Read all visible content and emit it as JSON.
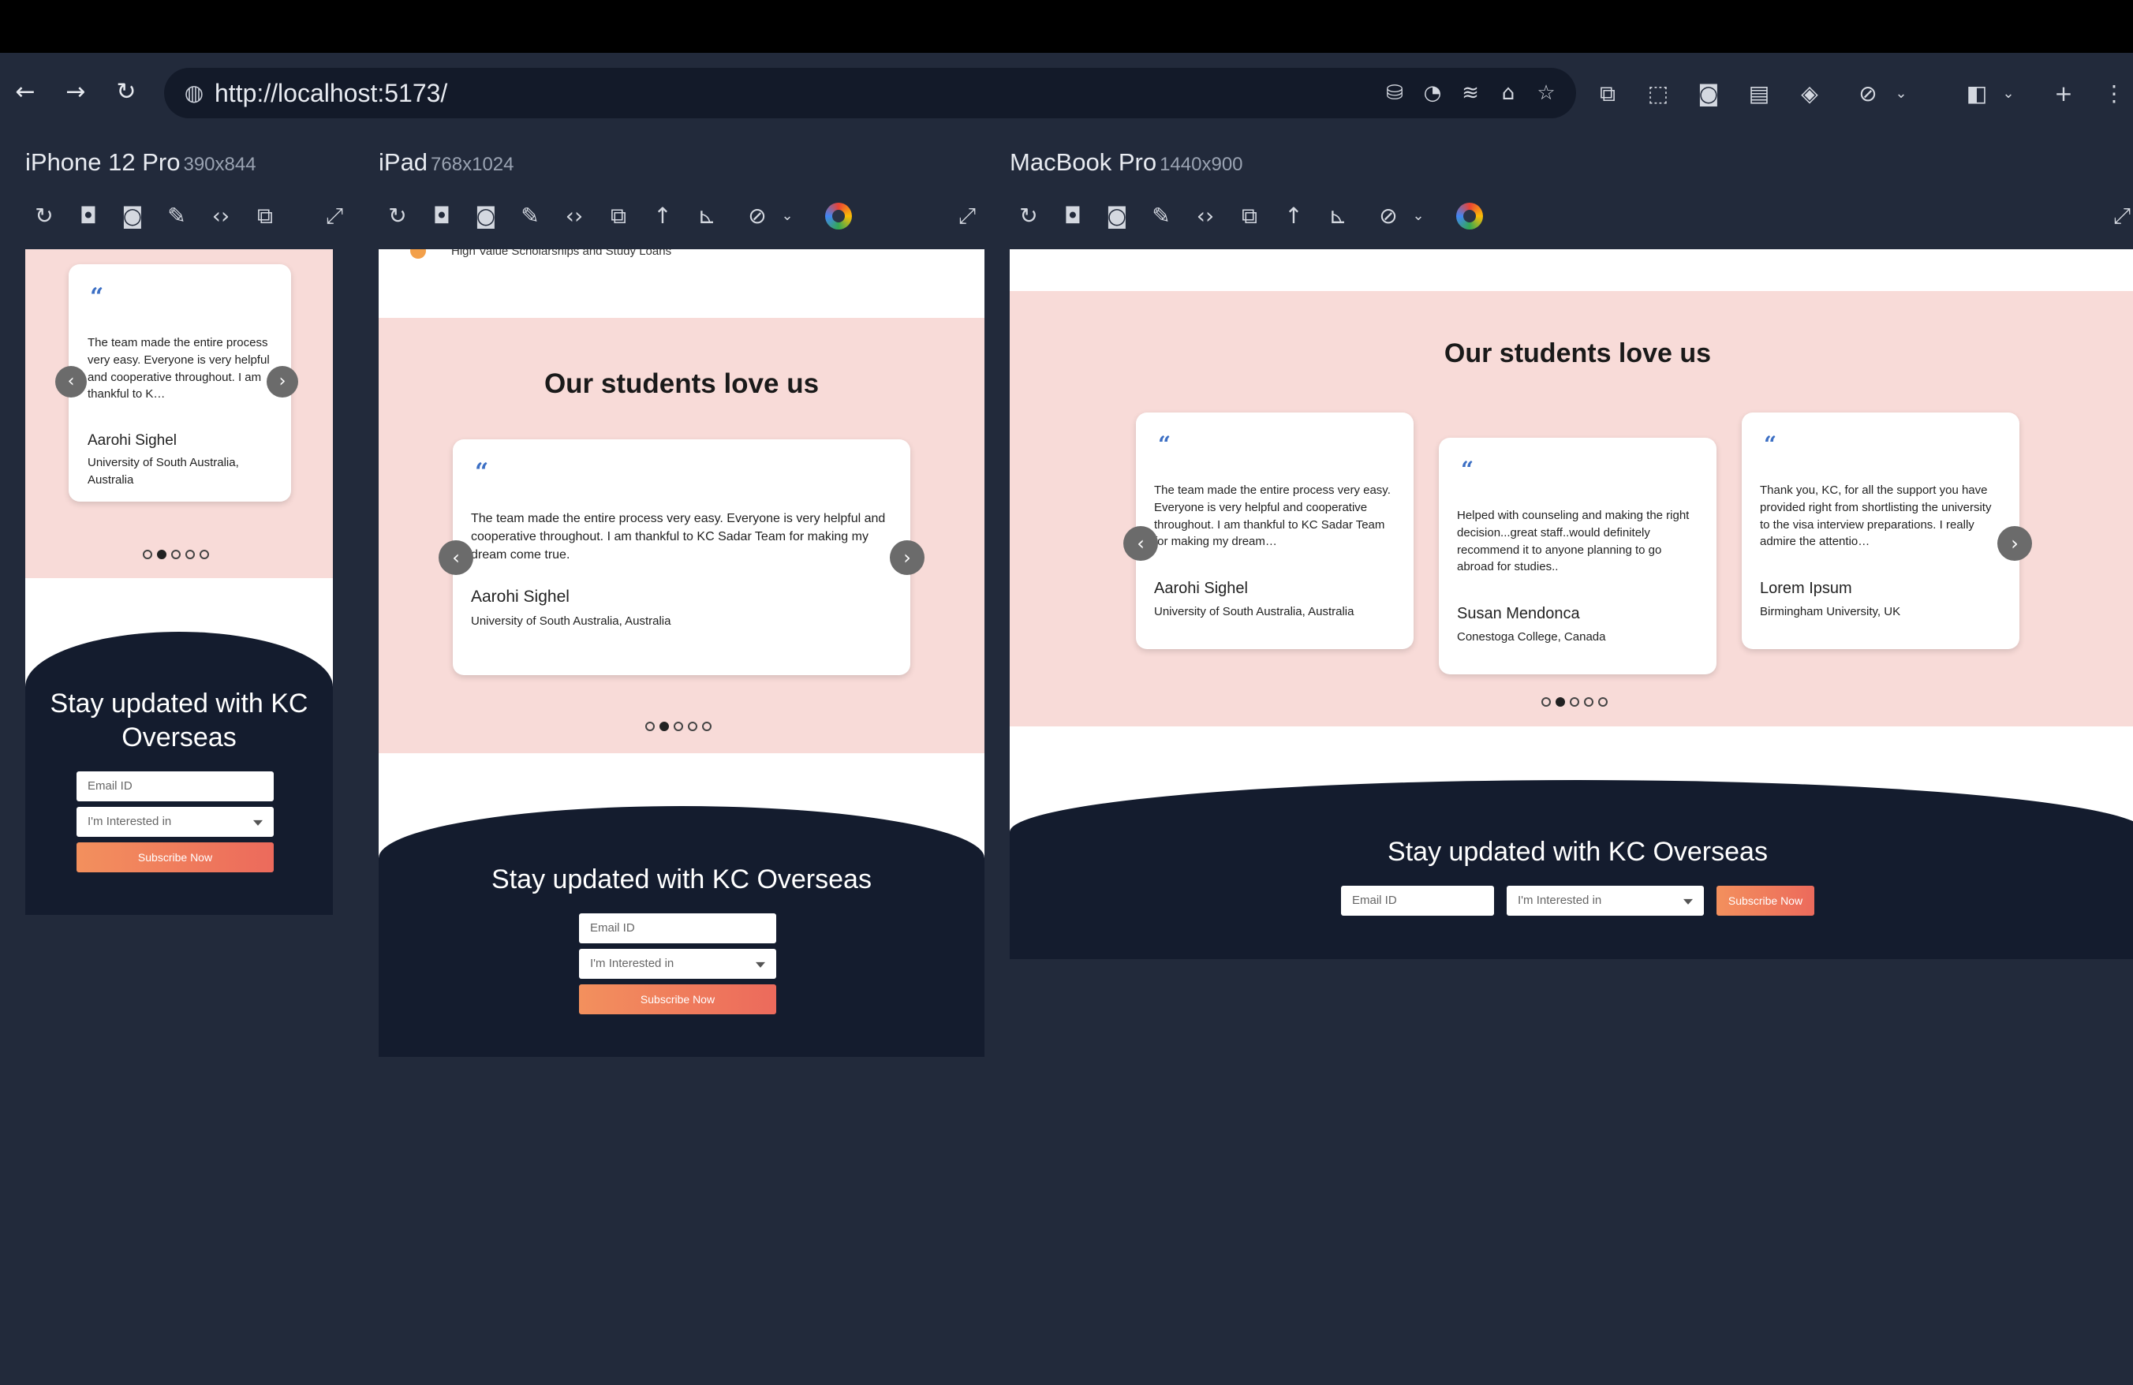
{
  "browser": {
    "url": "http://localhost:5173/"
  },
  "devices": [
    {
      "name": "iPhone 12 Pro",
      "size": "390x844"
    },
    {
      "name": "iPad",
      "size": "768x1024"
    },
    {
      "name": "MacBook Pro",
      "size": "1440x900"
    }
  ],
  "ipad_top_snippet": "High Value Scholarships and Study Loans",
  "section_title": "Our students love us",
  "testimonials": [
    {
      "quote": "The team made the entire process very easy. Everyone is very helpful and cooperative throughout. I am thankful to KC Sadar Team for making my dream come true.",
      "quote_short": "The team made the entire process very easy. Everyone is very helpful and cooperative throughout. I am thankful to K…",
      "quote_mac": "The team made the entire process very easy. Everyone is very helpful and cooperative throughout. I am thankful to KC Sadar Team for making my dream…",
      "name": "Aarohi Sighel",
      "university": "University of South Australia, Australia"
    },
    {
      "quote": "Helped with counseling and making the right decision...great staff..would definitely recommend it to anyone planning to go abroad for studies..",
      "name": "Susan Mendonca",
      "university": "Conestoga College, Canada"
    },
    {
      "quote": "Thank you, KC, for all the support you have provided right from shortlisting the university to the visa interview preparations. I really admire the attentio…",
      "name": "Lorem Ipsum",
      "university": "Birmingham University, UK"
    }
  ],
  "carousel": {
    "dot_count": 5,
    "active_index": 1
  },
  "newsletter": {
    "title": "Stay updated with KC Overseas",
    "email_placeholder": "Email ID",
    "interest_placeholder": "I'm Interested in",
    "subscribe_label": "Subscribe Now"
  },
  "colors": {
    "page_bg": "#222a3b",
    "testimonial_bg": "#f8dbd8",
    "newsletter_bg": "#141c2e",
    "quote_accent": "#3c6fc4",
    "button_gradient_start": "#f3905d",
    "button_gradient_end": "#ec6a5c"
  }
}
